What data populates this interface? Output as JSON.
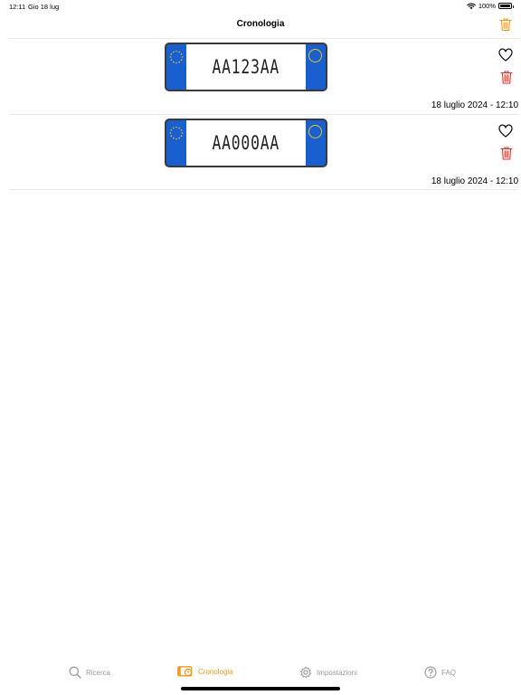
{
  "status_bar": {
    "time": "12:11",
    "date": "Gio 18 lug",
    "battery": "100%"
  },
  "nav": {
    "title": "Cronologia",
    "clear_icon": "trash-icon"
  },
  "colors": {
    "accent": "#f09a1e",
    "danger": "#e0342b",
    "plate_blue": "#1a5fd0",
    "plate_yellow": "#e7c80f",
    "inactive": "#9b9b9b"
  },
  "history": [
    {
      "plate": "AA123AA",
      "timestamp": "18 luglio 2024 - 12:10",
      "favorite": false
    },
    {
      "plate": "AA000AA",
      "timestamp": "18 luglio 2024 - 12:10",
      "favorite": false
    }
  ],
  "tabs": [
    {
      "label": "Ricerca",
      "icon": "search-icon",
      "active": false
    },
    {
      "label": "Cronologia",
      "icon": "history-plate-icon",
      "active": true
    },
    {
      "label": "Impostazioni",
      "icon": "gear-icon",
      "active": false
    },
    {
      "label": "FAQ",
      "icon": "question-circle-icon",
      "active": false
    }
  ]
}
